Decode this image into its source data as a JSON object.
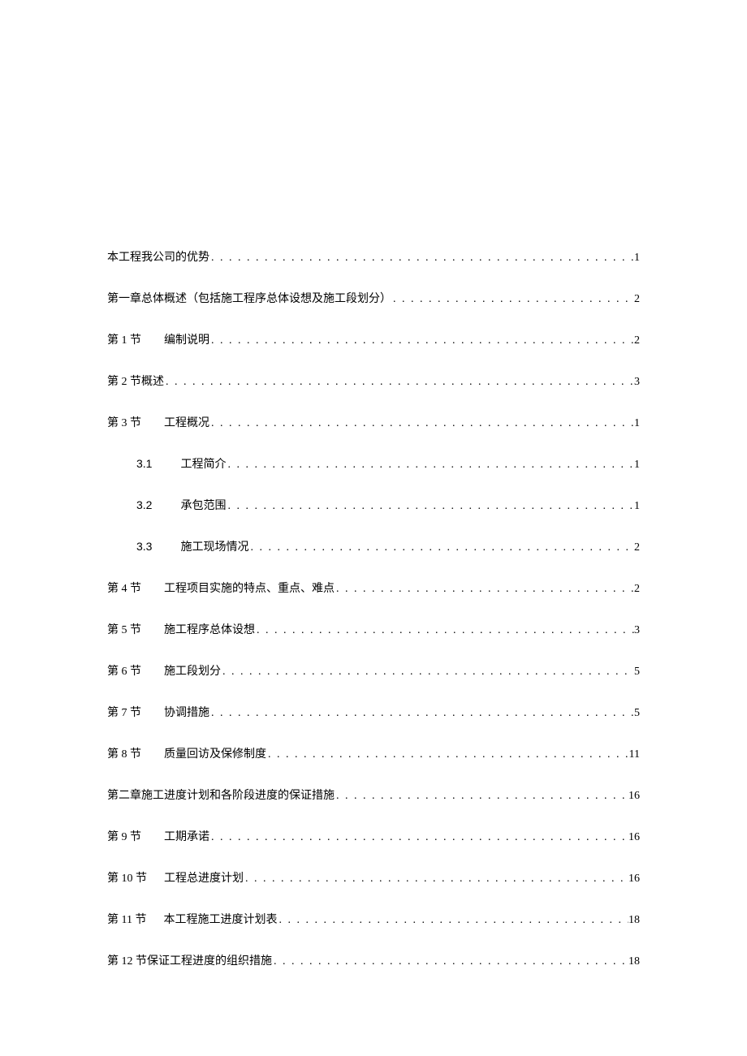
{
  "toc": [
    {
      "label": "",
      "title": "本工程我公司的优势",
      "page": "1",
      "indent": 0,
      "gap": ""
    },
    {
      "label": "",
      "title": "第一章总体概述（包括施工程序总体设想及施工段划分）",
      "page": "2",
      "indent": 0,
      "gap": ""
    },
    {
      "label": "第 1 节",
      "title": "编制说明",
      "page": "2",
      "indent": 0,
      "gap": "        "
    },
    {
      "label": "",
      "title": "第 2 节概述",
      "page": "3",
      "indent": 0,
      "gap": ""
    },
    {
      "label": "第 3 节",
      "title": "工程概况",
      "page": "1",
      "indent": 0,
      "gap": "        "
    },
    {
      "label": "3.1",
      "title": "工程简介",
      "page": "1",
      "indent": 1,
      "gap": "          ",
      "numlabel": true
    },
    {
      "label": "3.2",
      "title": "承包范围",
      "page": "1",
      "indent": 1,
      "gap": "          ",
      "numlabel": true
    },
    {
      "label": "3.3",
      "title": "施工现场情况",
      "page": "2",
      "indent": 1,
      "gap": "          ",
      "numlabel": true
    },
    {
      "label": "第 4 节",
      "title": "工程项目实施的特点、重点、难点",
      "page": "2",
      "indent": 0,
      "gap": "        "
    },
    {
      "label": "第 5 节",
      "title": "施工程序总体设想",
      "page": "3",
      "indent": 0,
      "gap": "        "
    },
    {
      "label": "第 6 节",
      "title": "施工段划分",
      "page": "5",
      "indent": 0,
      "gap": "        "
    },
    {
      "label": "第 7 节",
      "title": "协调措施",
      "page": "5",
      "indent": 0,
      "gap": "        "
    },
    {
      "label": "第 8 节",
      "title": "质量回访及保修制度",
      "page": "11",
      "indent": 0,
      "gap": "        "
    },
    {
      "label": "",
      "title": "第二章施工进度计划和各阶段进度的保证措施",
      "page": "16",
      "indent": 0,
      "gap": ""
    },
    {
      "label": "第 9 节",
      "title": "工期承诺",
      "page": "16",
      "indent": 0,
      "gap": "        "
    },
    {
      "label": "第 10 节",
      "title": "工程总进度计划",
      "page": "16",
      "indent": 0,
      "gap": "      "
    },
    {
      "label": "第 11 节",
      "title": "本工程施工进度计划表",
      "page": "18",
      "indent": 0,
      "gap": "      "
    },
    {
      "label": "",
      "title": "第 12 节保证工程进度的组织措施",
      "page": "18",
      "indent": 0,
      "gap": ""
    }
  ],
  "dots": ". . . . . . . . . . . . . . . . . . . . . . . . . . . . . . . . . . . . . . . . . . . . . . . . . . . . . . . . . . . . . . . . . . . . . . . . . . . . . . . . . . . . . . . . . . . . . . . . . . . . . . . . . . . ."
}
